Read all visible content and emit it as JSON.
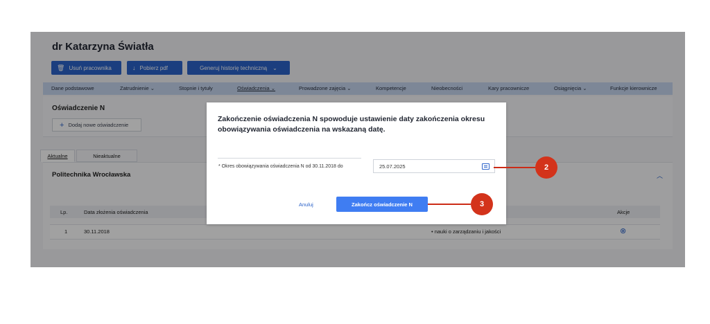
{
  "header": {
    "title": "dr Katarzyna Światła"
  },
  "toolbar": {
    "delete_label": "Usuń pracownika",
    "download_label": "Pobierz pdf",
    "generate_label": "Generuj historię techniczną"
  },
  "nav": {
    "items": [
      "Dane podstawowe",
      "Zatrudnienie",
      "Stopnie i tytuły",
      "Oświadczenia",
      "Prowadzone zajęcia",
      "Kompetencje",
      "Nieobecności",
      "Kary pracownicze",
      "Osiągnięcia",
      "Funkcje kierownicze"
    ],
    "active": "Oświadczenia"
  },
  "panel": {
    "title": "Oświadczenie N",
    "add_label": "Dodaj nowe oświadczenie"
  },
  "tabs": [
    "Aktualne",
    "Nieaktualne"
  ],
  "section": {
    "title": "Politechnika Wrocławska"
  },
  "table": {
    "headers": [
      "Lp.",
      "Data złożenia oświadczenia",
      "Akcje"
    ],
    "rows": [
      {
        "lp": "1",
        "date": "30.11.2018",
        "discipline": "• nauki o zarządzaniu i jakości"
      }
    ]
  },
  "modal": {
    "text": "Zakończenie oświadczenia N spowoduje ustawienie daty zakończenia okresu obowiązywania oświadczenia na wskazaną datę.",
    "label": "* Okres obowiązywania oświadczenia N od 30.11.2018 do",
    "date_value": "25.07.2025",
    "cancel_label": "Anuluj",
    "confirm_label": "Zakończ oświadczenie N"
  },
  "markers": [
    "2",
    "3"
  ],
  "colors": {
    "primary": "#2c63c9",
    "confirm": "#3f7df2",
    "marker": "#d3331b",
    "nav_bg": "#c7d6ef"
  }
}
